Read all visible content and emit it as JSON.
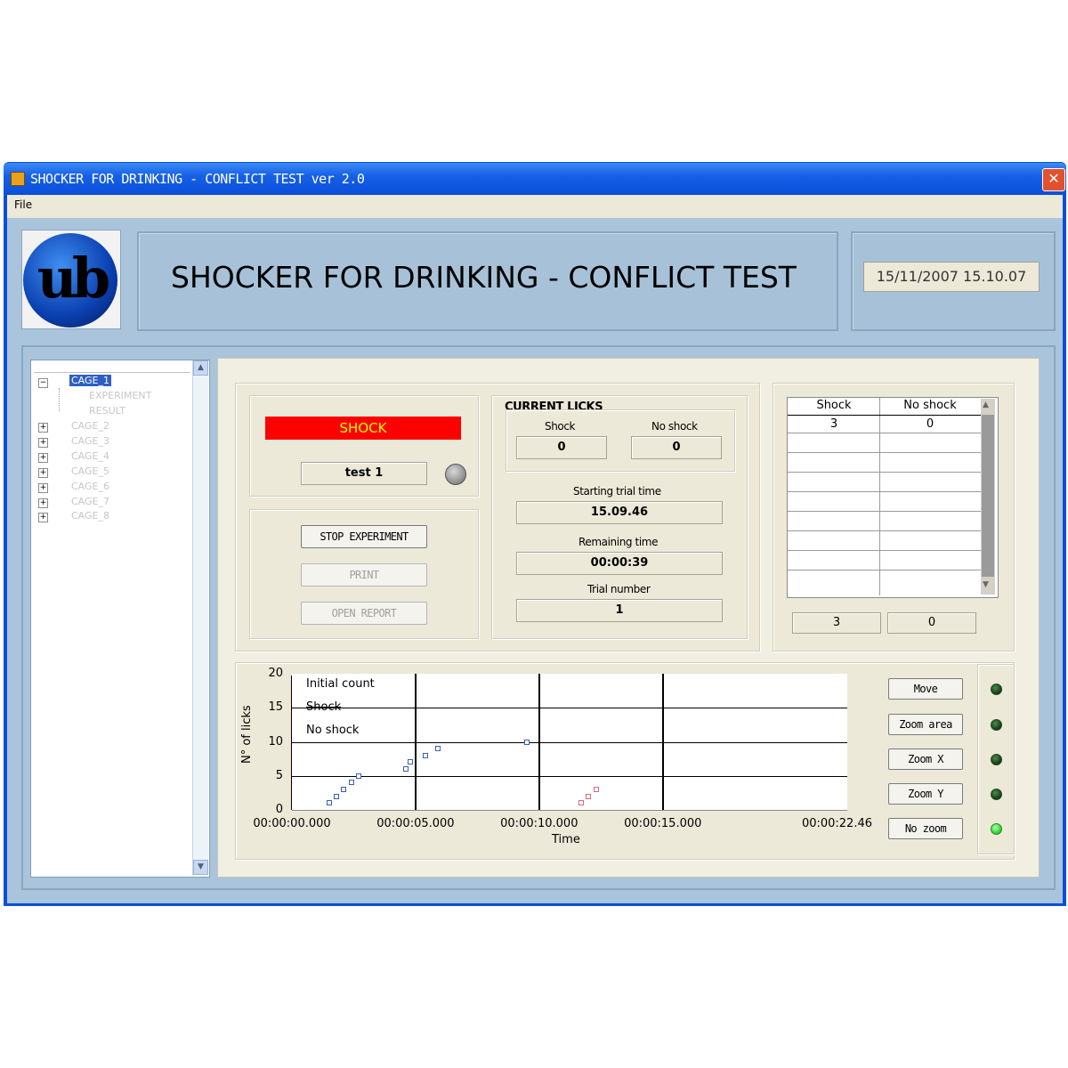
{
  "window": {
    "title": "SHOCKER FOR DRINKING - CONFLICT TEST ver 2.0",
    "close_glyph": "✕"
  },
  "menu": {
    "file_label": "File"
  },
  "header": {
    "logo_text": "ub",
    "app_title": "SHOCKER FOR DRINKING - CONFLICT TEST",
    "datetime": "15/11/2007 15.10.07"
  },
  "tree": {
    "items": [
      {
        "label": "CAGE_1",
        "selected": true
      },
      {
        "label": "EXPERIMENT"
      },
      {
        "label": "RESULT"
      },
      {
        "label": "CAGE_2"
      },
      {
        "label": "CAGE_3"
      },
      {
        "label": "CAGE_4"
      },
      {
        "label": "CAGE_5"
      },
      {
        "label": "CAGE_6"
      },
      {
        "label": "CAGE_7"
      },
      {
        "label": "CAGE_8"
      }
    ],
    "expand_glyph": "+",
    "collapse_glyph": "−"
  },
  "status": {
    "shock_label": "SHOCK",
    "test_name": "test 1",
    "indicator_color": "#ff0000",
    "indicator_text_color": "#ffff00"
  },
  "buttons": {
    "stop": "STOP EXPERIMENT",
    "print": "PRINT",
    "open_report": "OPEN REPORT"
  },
  "current_licks": {
    "title": "CURRENT LICKS",
    "shock_label": "Shock",
    "no_shock_label": "No shock",
    "shock_value": "0",
    "no_shock_value": "0"
  },
  "trial": {
    "start_label": "Starting trial time",
    "start_value": "15.09.46",
    "remaining_label": "Remaining time",
    "remaining_value": "00:00:39",
    "number_label": "Trial number",
    "number_value": "1"
  },
  "results_table": {
    "headers": [
      "Shock",
      "No shock"
    ],
    "rows": [
      [
        "3",
        "0"
      ]
    ],
    "totals": [
      "3",
      "0"
    ]
  },
  "plot_controls": {
    "move": "Move",
    "zoom_area": "Zoom area",
    "zoom_x": "Zoom X",
    "zoom_y": "Zoom Y",
    "no_zoom": "No zoom"
  },
  "chart_data": {
    "type": "scatter",
    "xlabel": "Time",
    "ylabel": "N° of licks",
    "xlim": [
      0,
      22.46
    ],
    "ylim": [
      0,
      20
    ],
    "x_tick_labels": [
      "00:00:00.000",
      "00:00:05.000",
      "00:00:10.000",
      "00:00:15.000",
      "00:00:22.46"
    ],
    "y_tick_labels": [
      "0",
      "5",
      "10",
      "15",
      "20"
    ],
    "x_ticks": [
      0,
      5,
      10,
      15,
      22.46
    ],
    "y_ticks": [
      0,
      5,
      10,
      15,
      20
    ],
    "series": [
      {
        "name": "Initial count",
        "color": "#3a5fb0",
        "x": [
          1.5,
          1.8,
          2.1,
          2.4,
          2.7,
          4.6,
          4.8,
          5.4,
          5.9,
          9.5
        ],
        "y": [
          1,
          2,
          3,
          4,
          5,
          6,
          7,
          8,
          9,
          10
        ]
      },
      {
        "name": "Shock",
        "color": "#d86a7a",
        "x": [
          11.7,
          12.0,
          12.3
        ],
        "y": [
          1,
          2,
          3
        ]
      },
      {
        "name": "No shock",
        "color": "#3aa05a",
        "x": [],
        "y": []
      }
    ]
  }
}
